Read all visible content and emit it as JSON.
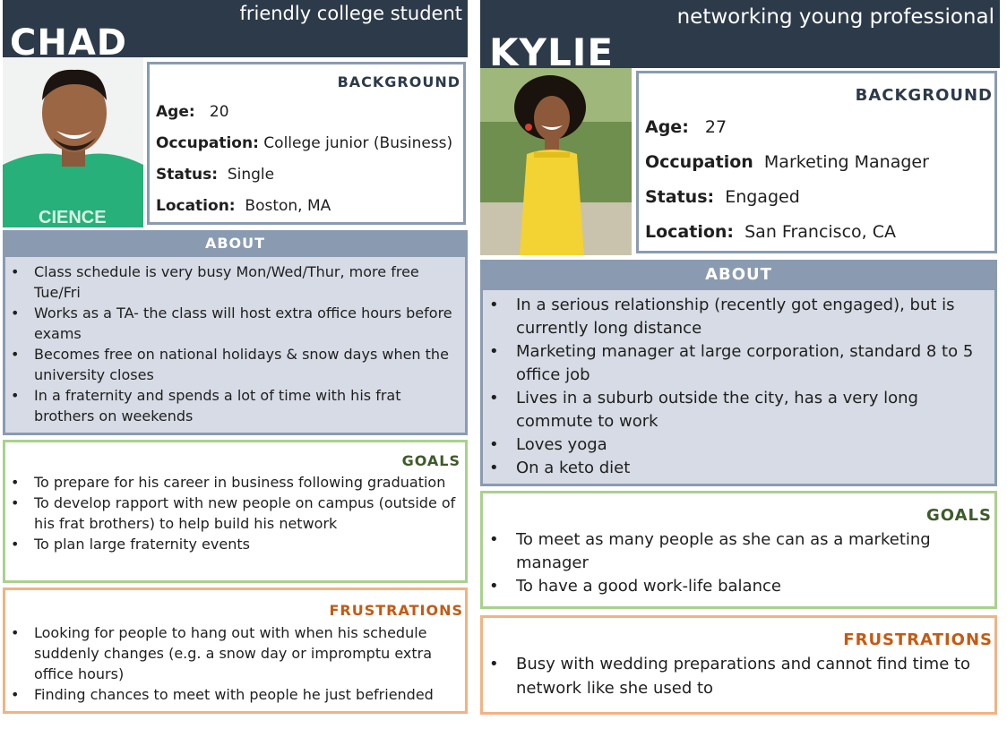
{
  "colors": {
    "header": "#2d3a4a",
    "about": "#8a9bb1",
    "about_body": "#d6dbe5",
    "goals_border": "#a9d18e",
    "goals_title": "#3d5b2a",
    "frustrations_border": "#f4b183",
    "frustrations_title": "#c55a11"
  },
  "chad": {
    "name": "CHAD",
    "tagline": "friendly college student",
    "photo_icon": "person-photo",
    "background_title": "BACKGROUND",
    "age_label": "Age:",
    "age": "20",
    "occupation_label": "Occupation:",
    "occupation": "College junior (Business)",
    "status_label": "Status:",
    "status": "Single",
    "location_label": "Location:",
    "location": "Boston, MA",
    "shirt_text": "CIENCE",
    "about_title": "ABOUT",
    "about": [
      "Class schedule is very busy Mon/Wed/Thur, more free Tue/Fri",
      "Works as a TA- the class will host extra office hours before exams",
      "Becomes free on national holidays & snow days when the university closes",
      "In a fraternity and spends a lot of time with his frat brothers on weekends"
    ],
    "goals_title": "GOALS",
    "goals": [
      "To prepare for his career in business following graduation",
      "To develop rapport with new people on campus (outside of his frat brothers) to help build his network",
      "To plan large fraternity events"
    ],
    "frustrations_title": "FRUSTRATIONS",
    "frustrations": [
      "Looking for people to hang out with when his schedule suddenly changes (e.g. a snow day or impromptu extra office hours)",
      "Finding chances to meet with people he just befriended"
    ]
  },
  "kylie": {
    "name": "KYLIE",
    "tagline": "networking young professional",
    "photo_icon": "person-photo",
    "background_title": "BACKGROUND",
    "age_label": "Age:",
    "age": "27",
    "occupation_label": "Occupation",
    "occupation": "Marketing Manager",
    "status_label": "Status:",
    "status": "Engaged",
    "location_label": "Location:",
    "location": "San Francisco, CA",
    "about_title": "ABOUT",
    "about": [
      "In a serious relationship (recently got engaged), but is currently long distance",
      "Marketing manager at large corporation, standard 8 to 5 office job",
      "Lives in a suburb outside the city, has a very long commute to work",
      "Loves yoga",
      "On a keto diet"
    ],
    "goals_title": "GOALS",
    "goals": [
      "To meet as many people as she can as a marketing manager",
      "To have a good work-life balance"
    ],
    "frustrations_title": "FRUSTRATIONS",
    "frustrations": [
      "Busy with wedding preparations and cannot find time to network like she used to"
    ]
  }
}
